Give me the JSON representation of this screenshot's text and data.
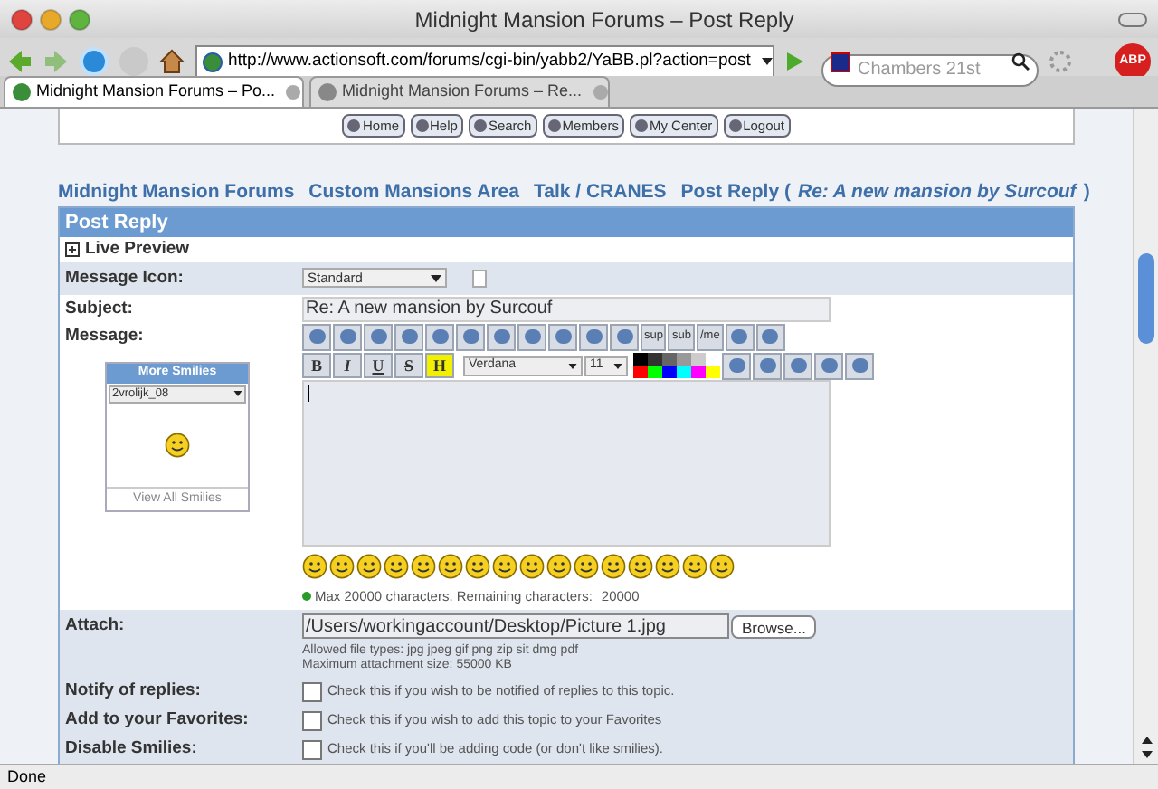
{
  "window": {
    "title": "Midnight Mansion Forums – Post Reply"
  },
  "toolbar": {
    "url": "http://www.actionsoft.com/forums/cgi-bin/yabb2/YaBB.pl?action=post",
    "search": {
      "placeholder": "Chambers 21st"
    },
    "adblock": "ABP"
  },
  "tabs": [
    {
      "label": "Midnight Mansion Forums – Po...",
      "selected": true
    },
    {
      "label": "Midnight Mansion Forums – Re...",
      "selected": false
    }
  ],
  "nav_buttons": [
    "Home",
    "Help",
    "Search",
    "Members",
    "My Center",
    "Logout"
  ],
  "breadcrumb": {
    "parts": [
      "Midnight Mansion Forums",
      "Custom Mansions Area",
      "Talk / CRANES",
      "Post Reply ("
    ],
    "topic": "Re: A new mansion by Surcouf",
    "close": ")"
  },
  "form": {
    "title": "Post Reply",
    "live_preview": "Live Preview",
    "message_icon": {
      "label": "Message Icon:",
      "value": "Standard"
    },
    "subject": {
      "label": "Subject:",
      "value": "Re: A new mansion by Surcouf"
    },
    "message": {
      "label": "Message:",
      "more_smilies": {
        "title": "More Smilies",
        "select": "2vrolijk_08",
        "link": "View All Smilies"
      },
      "editor_tools": [
        "sup",
        "sub",
        "/me"
      ],
      "format_buttons": [
        "B",
        "I",
        "U",
        "S",
        "H"
      ],
      "font": "Verdana",
      "size": "11",
      "palette": [
        {
          "color": "#000000"
        },
        {
          "color": "#333333"
        },
        {
          "color": "#666666"
        },
        {
          "color": "#999999"
        },
        {
          "color": "#cccccc"
        },
        {
          "color": "#ffffff"
        },
        {
          "color": "#ff0000"
        },
        {
          "color": "#00ff00"
        },
        {
          "color": "#0000ff"
        },
        {
          "color": "#00ffff"
        },
        {
          "color": "#ff00ff"
        },
        {
          "color": "#ffff00"
        }
      ],
      "limit": "Max 20000 characters. Remaining characters:",
      "remaining": "20000"
    },
    "attach": {
      "label": "Attach:",
      "value": "/Users/workingaccount/Desktop/Picture 1.jpg",
      "browse": "Browse...",
      "types": "Allowed file types: jpg jpeg gif png zip sit dmg pdf",
      "max": "Maximum attachment size: 55000 KB"
    },
    "options": [
      {
        "label": "Notify of replies:",
        "text": "Check this if you wish to be notified of replies to this topic.",
        "checked": false
      },
      {
        "label": "Add to your Favorites:",
        "text": "Check this if you wish to add this topic to your Favorites",
        "checked": false
      },
      {
        "label": "Disable Smilies:",
        "text": "Check this if you'll be adding code (or don't like smilies).",
        "checked": false
      }
    ]
  },
  "status_bar": "Done"
}
